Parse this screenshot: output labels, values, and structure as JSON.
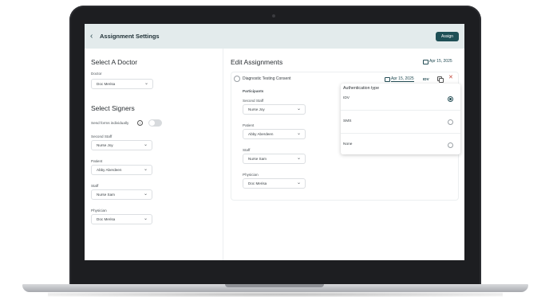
{
  "header": {
    "back_icon": "chevron-left-icon",
    "title": "Assignment Settings",
    "assign_label": "Assign",
    "accent": "#1e4f56",
    "bar_color": "#e3ebec"
  },
  "left": {
    "doctor_section_title": "Select A Doctor",
    "doctor_label": "Doctor",
    "doctor_value": "Doc Merisa",
    "signers_title": "Select Signers",
    "send_forms_label": "Send forms individually",
    "send_forms_enabled": false,
    "second_staff_label": "Second Staff",
    "second_staff_value": "Nurse Joy",
    "patient_label": "Patient",
    "patient_value": "Abby Aberdeen",
    "staff_label": "Staff",
    "staff_value": "Nurse Sam",
    "physician_label": "Physician",
    "physician_value": "Doc Merisa"
  },
  "right": {
    "title": "Edit Assignments",
    "header_date": "Apr 15, 2025",
    "assignment": {
      "name": "Diagnostic Testing Consent",
      "date": "Apr 15, 2025",
      "auth_tag": "IDV",
      "participants_label": "Participants",
      "second_staff_label": "Second Staff",
      "second_staff_value": "Nurse Joy",
      "patient_label": "Patient",
      "patient_value": "Abby Aberdeen",
      "staff_label": "Staff",
      "staff_value": "Nurse Sam",
      "physician_label": "Physician",
      "physician_value": "Doc Merisa"
    }
  },
  "auth_popup": {
    "title": "Authentication type",
    "options": [
      {
        "label": "IDV",
        "selected": true
      },
      {
        "label": "SMS",
        "selected": false
      },
      {
        "label": "None",
        "selected": false
      }
    ]
  }
}
